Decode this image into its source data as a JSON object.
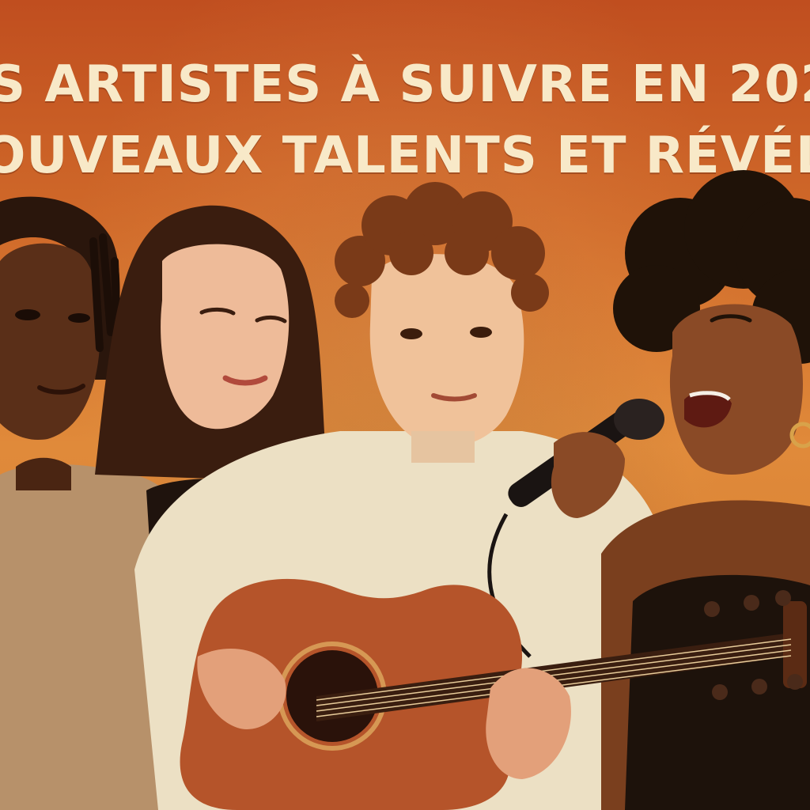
{
  "headline": {
    "line1": "S ARTISTES À SUIVRE EN 202",
    "line2": "OUVEAUX TALENTS ET RÉVÉLATION"
  },
  "colors": {
    "background_top": "#c04e1f",
    "background_bottom": "#e08a3a",
    "headline_text": "#f8e9c8"
  },
  "scene": {
    "figures": [
      "man-with-dreadlocks",
      "woman-with-long-dark-hair",
      "curly-haired-young-man-playing-guitar",
      "woman-singing-into-microphone"
    ]
  }
}
